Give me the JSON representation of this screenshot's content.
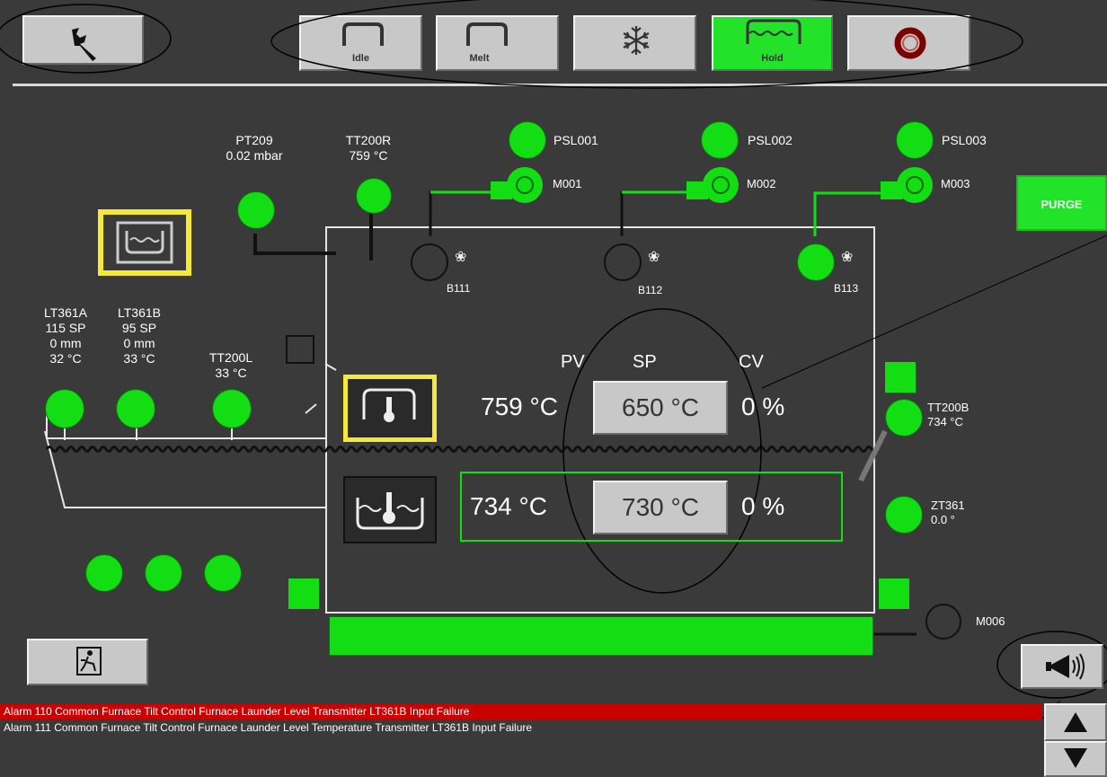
{
  "toolbar": {
    "modes": [
      {
        "label": "Idle",
        "active": false
      },
      {
        "label": "Melt",
        "active": false
      },
      {
        "label": "",
        "icon": "snowflake-icon",
        "active": false
      },
      {
        "label": "Hold",
        "active": true
      },
      {
        "label": "",
        "icon": "stop-ring-icon",
        "active": false
      }
    ]
  },
  "sensors": {
    "pt209": {
      "name": "PT209",
      "value": "0.02 mbar"
    },
    "tt200r": {
      "name": "TT200R",
      "value": "759 °C"
    },
    "psl001": "PSL001",
    "psl002": "PSL002",
    "psl003": "PSL003",
    "m001": "M001",
    "m002": "M002",
    "m003": "M003",
    "b111": "B111",
    "b112": "B112",
    "b113": "B113",
    "lt361a": {
      "name": "LT361A",
      "sp": "115 SP",
      "level": "0 mm",
      "temp": "32 °C"
    },
    "lt361b": {
      "name": "LT361B",
      "sp": "95 SP",
      "level": "0 mm",
      "temp": "33 °C"
    },
    "tt200l": {
      "name": "TT200L",
      "temp": "33 °C"
    },
    "tt200b": {
      "name": "TT200B",
      "value": "734 °C"
    },
    "zt361": {
      "name": "ZT361",
      "value": "0.0 °"
    },
    "m006": "M006"
  },
  "purge_label": "PURGE",
  "control": {
    "headers": {
      "pv": "PV",
      "sp": "SP",
      "cv": "CV"
    },
    "roof": {
      "pv": "759 °C",
      "sp": "650 °C",
      "cv": "0 %"
    },
    "bath": {
      "pv": "734 °C",
      "sp": "730 °C",
      "cv": "0 %"
    }
  },
  "alarms": [
    {
      "text": "Alarm 110 Common Furnace Tilt Control Furnace Launder Level Transmitter LT361B Input Failure",
      "active": true
    },
    {
      "text": "Alarm 111 Common Furnace Tilt Control Furnace Launder Level Temperature Transmitter LT361B Input Failure",
      "active": false
    }
  ],
  "colors": {
    "green": "#13dd13",
    "alarm_red": "#c80000",
    "panel": "#3a3a3a",
    "yellow": "#f5e83a"
  }
}
